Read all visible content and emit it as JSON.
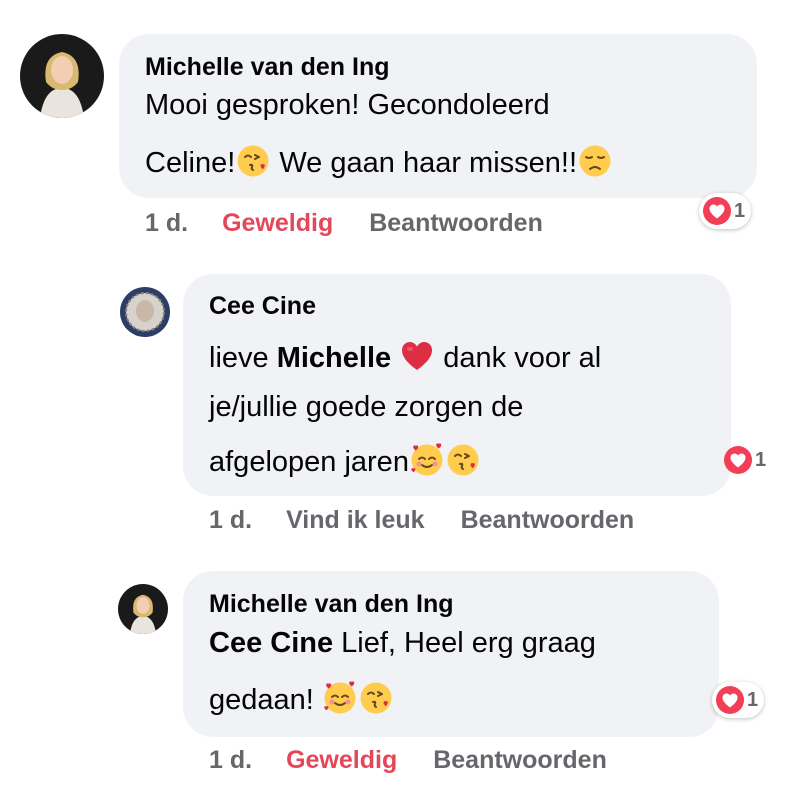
{
  "comments": [
    {
      "author": "Michelle van den Ing",
      "line1": "Mooi gesproken! Gecondoleerd",
      "line2a": "Celine!",
      "line2b": " We gaan haar missen!!",
      "time": "1 d.",
      "react_label": "Geweldig",
      "react_color": "#e4475a",
      "reply_label": "Beantwoorden",
      "reaction_icon": "heart-icon",
      "reaction_count": "1"
    },
    {
      "author": "Cee Cine",
      "line1_pre": "lieve ",
      "line1_mention": "Michelle",
      "line1_post": " dank voor al",
      "line2": "je/jullie goede zorgen de",
      "line3": "afgelopen jaren",
      "time": "1 d.",
      "react_label": "Vind ik leuk",
      "reply_label": "Beantwoorden",
      "reaction_icon": "heart-icon",
      "reaction_count": "1"
    },
    {
      "author": "Michelle van den Ing",
      "line1_mention": "Cee Cine",
      "line1_post": " Lief, Heel erg graag",
      "line2": "gedaan! ",
      "time": "1 d.",
      "react_label": "Geweldig",
      "react_color": "#e4475a",
      "reply_label": "Beantwoorden",
      "reaction_icon": "heart-icon",
      "reaction_count": "1"
    }
  ],
  "colors": {
    "bubble": "#f0f2f5",
    "secondary_text": "#65676b",
    "love": "#e4475a",
    "heart": "#f33e58"
  }
}
